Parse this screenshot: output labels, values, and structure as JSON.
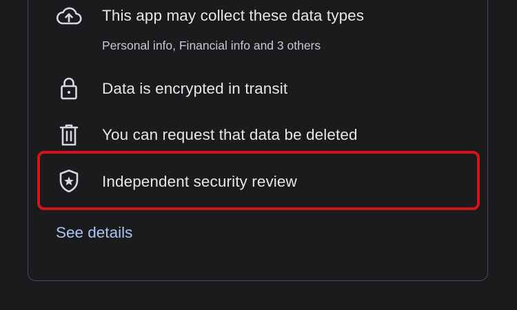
{
  "data_safety": {
    "items": [
      {
        "icon": "cloud-upload-icon",
        "title": "This app may collect these data types",
        "subtitle": "Personal info, Financial info and 3 others"
      },
      {
        "icon": "lock-icon",
        "title": "Data is encrypted in transit"
      },
      {
        "icon": "trash-icon",
        "title": "You can request that data be deleted"
      },
      {
        "icon": "shield-star-icon",
        "title": "Independent security review",
        "highlighted": true
      }
    ],
    "see_details_label": "See details"
  },
  "colors": {
    "background": "#1b1b1d",
    "text": "#e6e6e9",
    "link": "#a9c4f5",
    "highlight_border": "#d6131b",
    "card_border": "#4a4a4f"
  }
}
